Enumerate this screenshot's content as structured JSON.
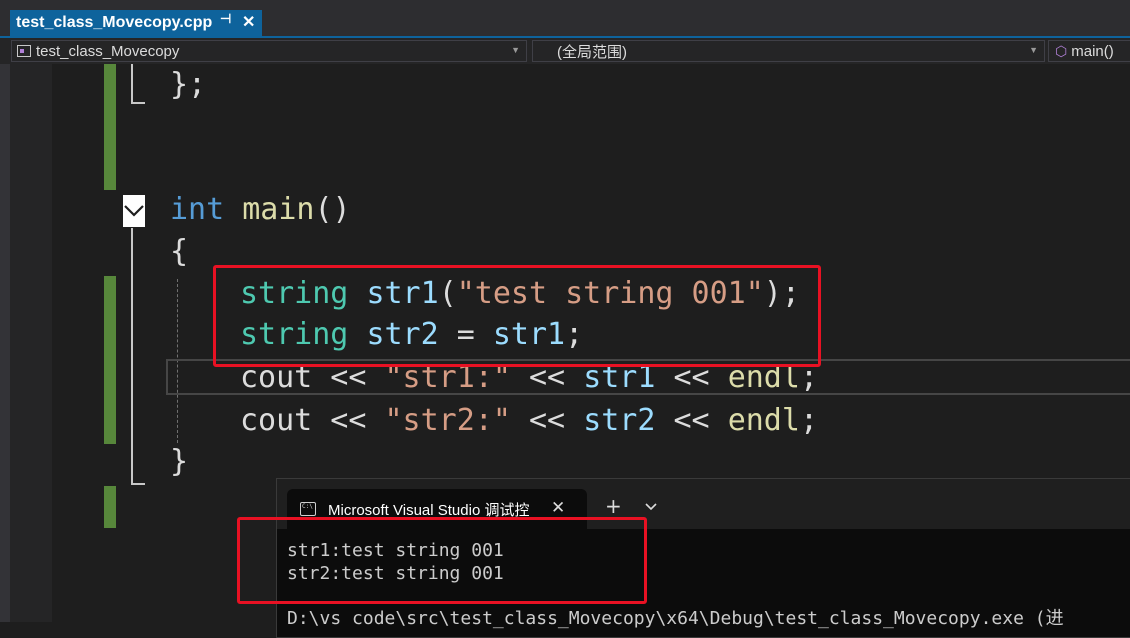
{
  "tabs": {
    "active_file": "test_class_Movecopy.cpp",
    "pin_glyph": "⊣",
    "close_glyph": "✕"
  },
  "navbar": {
    "project": "test_class_Movecopy",
    "scope": "(全局范围)",
    "function": "main()"
  },
  "code": {
    "l1": "};",
    "l2_kw": "int",
    "l2_fn": "main",
    "l2_paren": "()",
    "l3": "{",
    "l4_type": "string",
    "l4_var": "str1",
    "l4_open": "(",
    "l4_str": "\"test string 001\"",
    "l4_close": ");",
    "l5_type": "string",
    "l5_var": "str2",
    "l5_eq": " = ",
    "l5_var2": "str1",
    "l5_semi": ";",
    "l6_cout": "cout",
    "l6_op1": " << ",
    "l6_str": "\"str1:\"",
    "l6_op2": " << ",
    "l6_var": "str1",
    "l6_op3": " << ",
    "l6_endl": "endl",
    "l6_semi": ";",
    "l7_cout": "cout",
    "l7_op1": " << ",
    "l7_str": "\"str2:\"",
    "l7_op2": " << ",
    "l7_var": "str2",
    "l7_op3": " << ",
    "l7_endl": "endl",
    "l7_semi": ";",
    "l8": "}"
  },
  "console": {
    "tab_title": "Microsoft Visual Studio 调试控",
    "icon_text": "C:\\",
    "close_glyph": "✕",
    "add_glyph": "+",
    "output_line1": "str1:test string 001",
    "output_line2": "str2:test string 001",
    "path_line": "D:\\vs code\\src\\test_class_Movecopy\\x64\\Debug\\test_class_Movecopy.exe (进"
  },
  "colors": {
    "keyword": "#569cd6",
    "type": "#4ec9b0",
    "function": "#dcdcaa",
    "variable": "#9cdcfe",
    "string": "#d69d85",
    "highlight_box": "#e81123",
    "change_bar": "#57873b",
    "accent_tab": "#0e639c"
  }
}
